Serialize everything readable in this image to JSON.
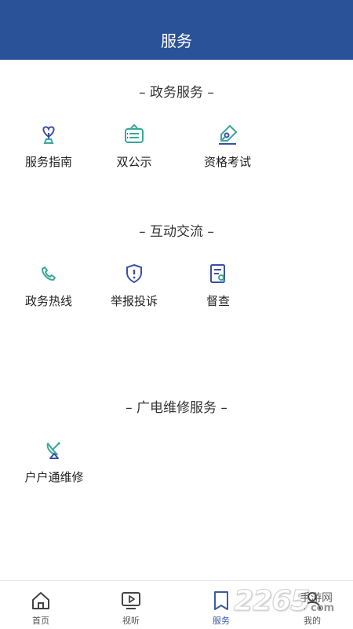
{
  "header": {
    "title": "服务"
  },
  "sections": [
    {
      "title": "– 政务服务 –",
      "items": [
        {
          "label": "服务指南",
          "icon": "heart-trophy-icon"
        },
        {
          "label": "双公示",
          "icon": "signboard-icon"
        },
        {
          "label": "资格考试",
          "icon": "pen-certificate-icon"
        }
      ]
    },
    {
      "title": "– 互动交流 –",
      "items": [
        {
          "label": "政务热线",
          "icon": "phone-icon"
        },
        {
          "label": "举报投诉",
          "icon": "shield-alert-icon"
        },
        {
          "label": "督查",
          "icon": "document-search-icon"
        }
      ]
    },
    {
      "title": "– 广电维修服务 –",
      "items": [
        {
          "label": "户户通维修",
          "icon": "satellite-dish-icon"
        }
      ]
    }
  ],
  "tabbar": {
    "items": [
      {
        "label": "首页",
        "icon": "home-icon",
        "active": false
      },
      {
        "label": "视听",
        "icon": "tv-play-icon",
        "active": false
      },
      {
        "label": "服务",
        "icon": "bookmark-icon",
        "active": true
      },
      {
        "label": "我的",
        "icon": "user-icon",
        "active": false
      }
    ]
  },
  "watermark": {
    "number": "2265",
    "text": "手游网",
    "domain": "com"
  },
  "colors": {
    "header": "#2a5298",
    "accent_teal": "#3aa89a",
    "accent_blue": "#3b4fa8",
    "tab_active": "#3b5ba5"
  }
}
